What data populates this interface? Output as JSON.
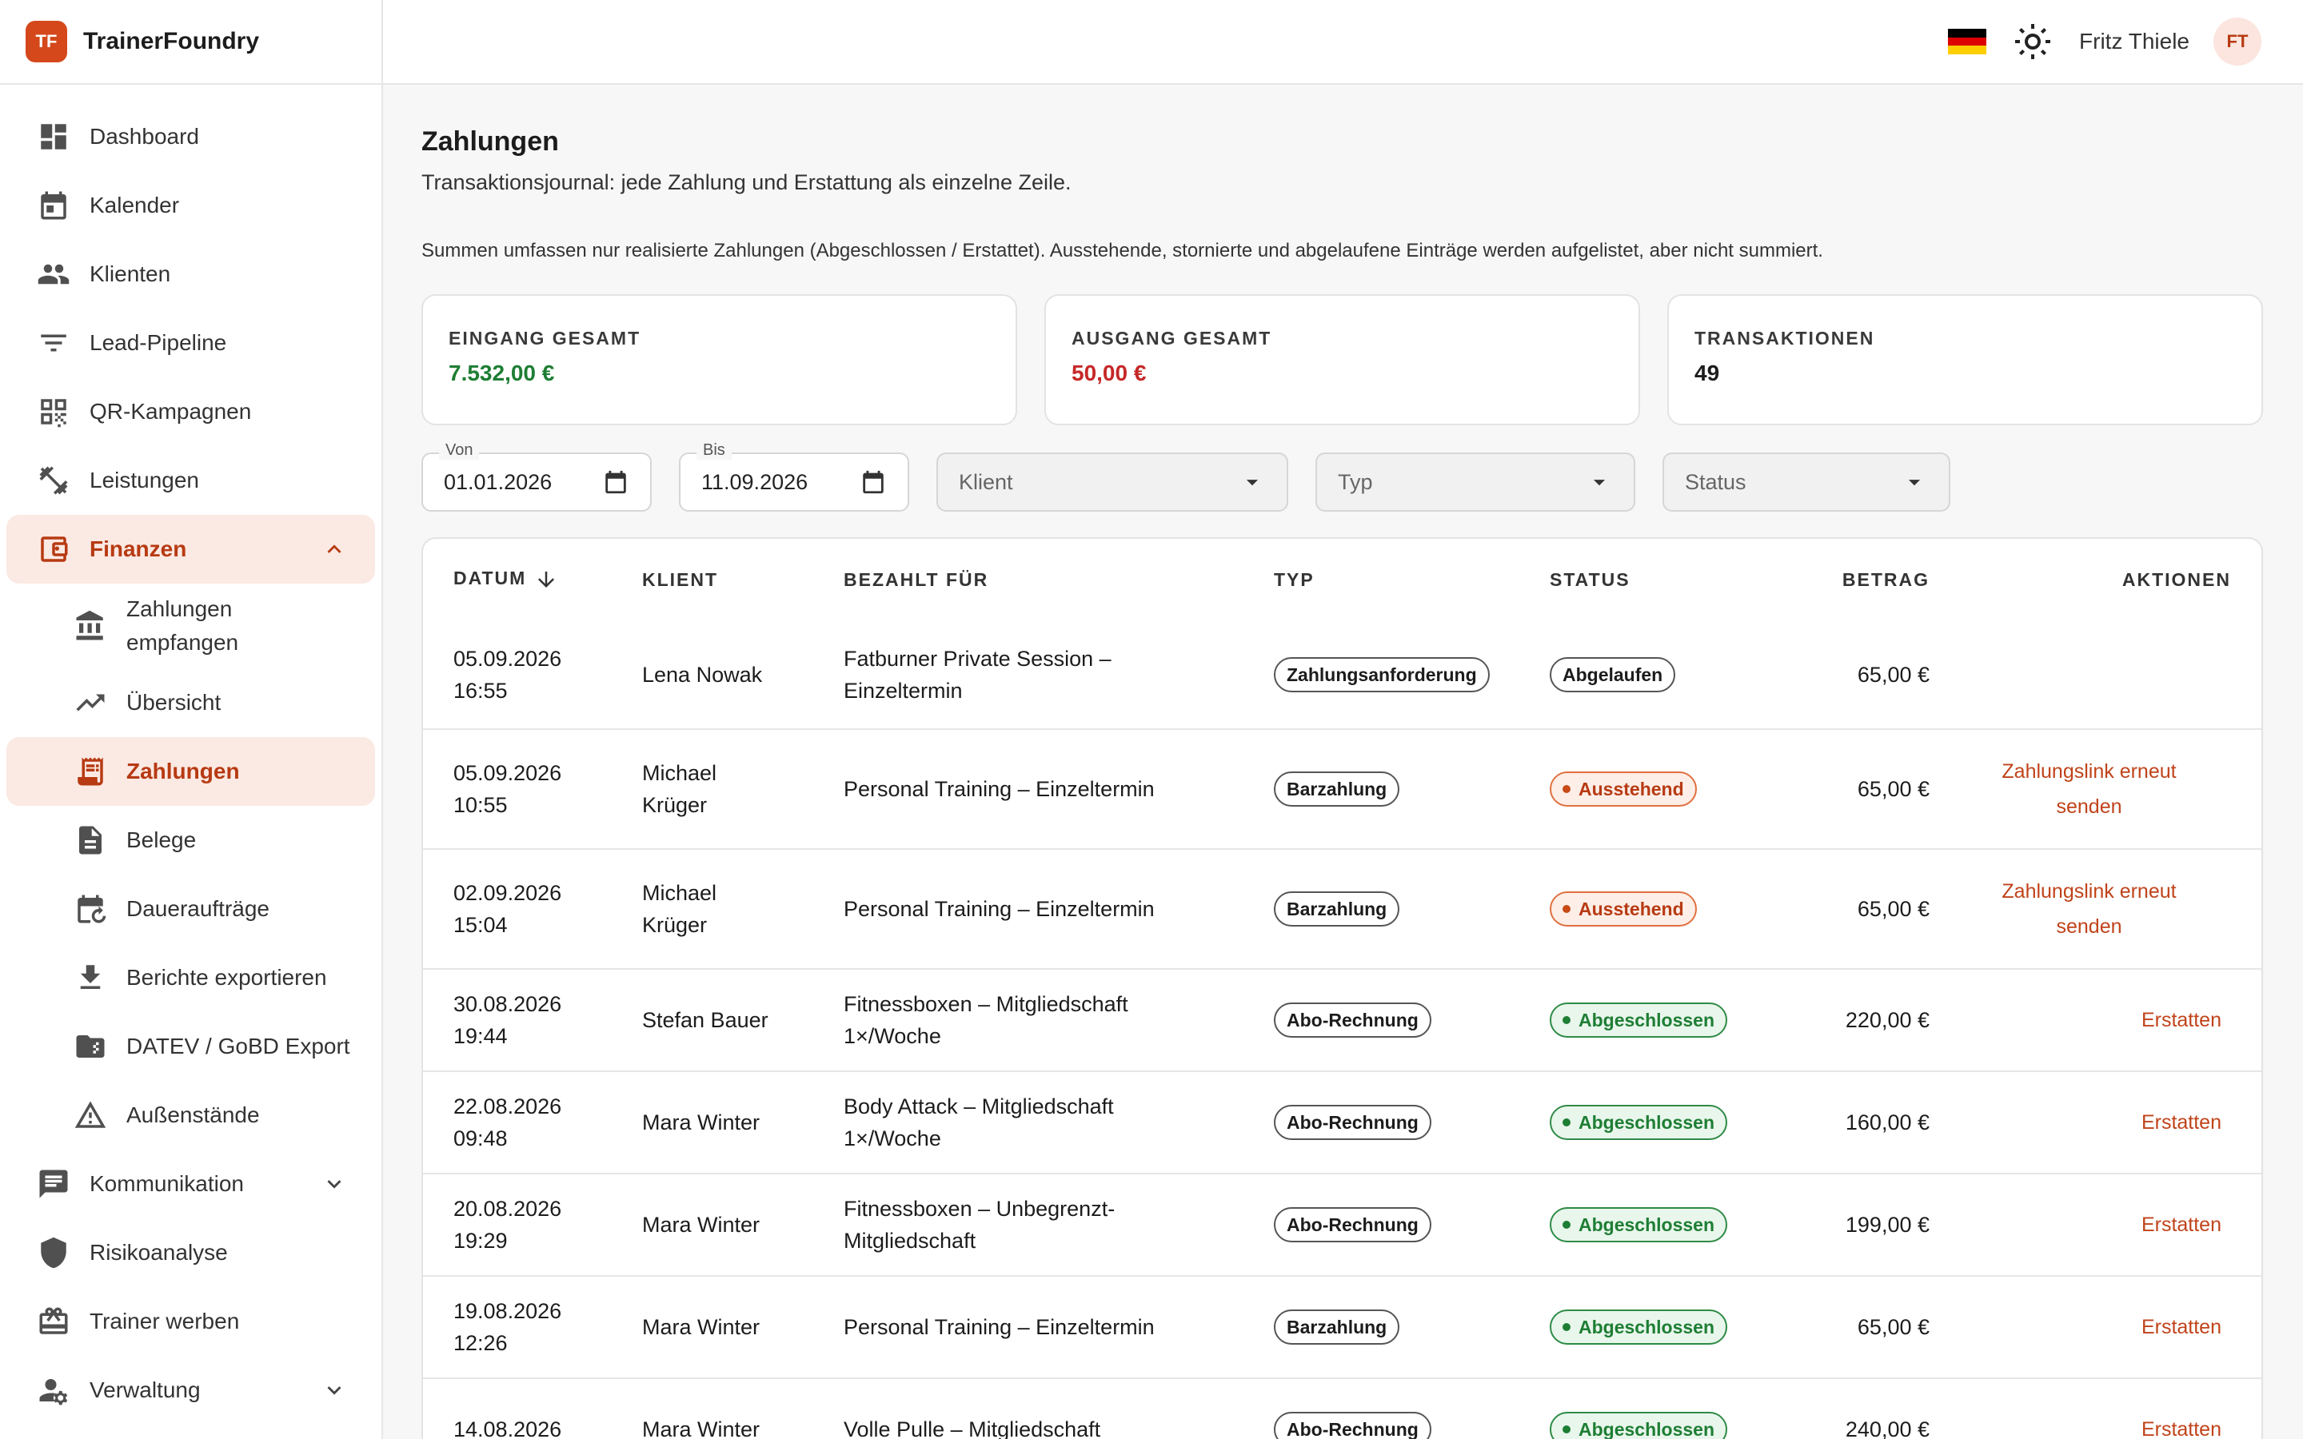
{
  "brand": {
    "logo": "TF",
    "name": "TrainerFoundry"
  },
  "sidebar": {
    "items": [
      {
        "label": "Dashboard",
        "icon": "dashboard-icon"
      },
      {
        "label": "Kalender",
        "icon": "calendar-icon"
      },
      {
        "label": "Klienten",
        "icon": "people-icon"
      },
      {
        "label": "Lead-Pipeline",
        "icon": "filter-icon"
      },
      {
        "label": "QR-Kampagnen",
        "icon": "qr-code-icon"
      },
      {
        "label": "Leistungen",
        "icon": "dumbbell-icon"
      },
      {
        "label": "Finanzen",
        "icon": "wallet-icon"
      },
      {
        "label": "Zahlungen empfangen",
        "icon": "bank-icon"
      },
      {
        "label": "Übersicht",
        "icon": "trending-up-icon"
      },
      {
        "label": "Zahlungen",
        "icon": "receipt-icon"
      },
      {
        "label": "Belege",
        "icon": "document-icon"
      },
      {
        "label": "Daueraufträge",
        "icon": "recurring-calendar-icon"
      },
      {
        "label": "Berichte exportieren",
        "icon": "download-icon"
      },
      {
        "label": "DATEV / GoBD Export",
        "icon": "folder-export-icon"
      },
      {
        "label": "Außenstände",
        "icon": "warning-icon"
      },
      {
        "label": "Kommunikation",
        "icon": "chat-icon"
      },
      {
        "label": "Risikoanalyse",
        "icon": "shield-icon"
      },
      {
        "label": "Trainer werben",
        "icon": "gift-icon"
      },
      {
        "label": "Verwaltung",
        "icon": "user-settings-icon"
      }
    ]
  },
  "topbar": {
    "user_name": "Fritz Thiele",
    "avatar": "FT",
    "language_flag": "de-flag-icon",
    "theme_icon": "sun-icon"
  },
  "page": {
    "title": "Zahlungen",
    "subtitle": "Transaktionsjournal: jede Zahlung und Erstattung als einzelne Zeile.",
    "note": "Summen umfassen nur realisierte Zahlungen (Abgeschlossen / Erstattet). Ausstehende, stornierte und abgelaufene Einträge werden aufgelistet, aber nicht summiert."
  },
  "summary": {
    "incoming": {
      "label": "EINGANG GESAMT",
      "value": "7.532,00 €",
      "color": "#1e7e34"
    },
    "outgoing": {
      "label": "AUSGANG GESAMT",
      "value": "50,00 €",
      "color": "#c62828"
    },
    "transactions": {
      "label": "TRANSAKTIONEN",
      "value": "49"
    }
  },
  "filters": {
    "from": {
      "label": "Von",
      "value": "01.01.2026"
    },
    "to": {
      "label": "Bis",
      "value": "11.09.2026"
    },
    "client": {
      "placeholder": "Klient"
    },
    "type": {
      "placeholder": "Typ"
    },
    "status": {
      "placeholder": "Status"
    }
  },
  "table": {
    "columns": {
      "date": "DATUM",
      "client": "KLIENT",
      "paid_for": "BEZAHLT FÜR",
      "type": "TYP",
      "status": "STATUS",
      "amount": "BETRAG",
      "actions": "AKTIONEN"
    },
    "rows": [
      {
        "date": "05.09.2026",
        "time": "16:55",
        "client_l1": "Lena Nowak",
        "client_l2": "",
        "paid_l1": "Fatburner Private Session –",
        "paid_l2": "Einzeltermin",
        "type": "Zahlungsanforderung",
        "status": "Abgelaufen",
        "amount": "65,00 €",
        "action_l1": "",
        "action_l2": ""
      },
      {
        "date": "05.09.2026",
        "time": "10:55",
        "client_l1": "Michael",
        "client_l2": "Krüger",
        "paid_l1": "Personal Training – Einzeltermin",
        "paid_l2": "",
        "type": "Barzahlung",
        "status": "Ausstehend",
        "amount": "65,00 €",
        "action_l1": "Zahlungslink erneut",
        "action_l2": "senden"
      },
      {
        "date": "02.09.2026",
        "time": "15:04",
        "client_l1": "Michael",
        "client_l2": "Krüger",
        "paid_l1": "Personal Training – Einzeltermin",
        "paid_l2": "",
        "type": "Barzahlung",
        "status": "Ausstehend",
        "amount": "65,00 €",
        "action_l1": "Zahlungslink erneut",
        "action_l2": "senden"
      },
      {
        "date": "30.08.2026",
        "time": "19:44",
        "client_l1": "Stefan Bauer",
        "client_l2": "",
        "paid_l1": "Fitnessboxen – Mitgliedschaft",
        "paid_l2": "1×/Woche",
        "type": "Abo-Rechnung",
        "status": "Abgeschlossen",
        "amount": "220,00 €",
        "action_l1": "Erstatten",
        "action_l2": ""
      },
      {
        "date": "22.08.2026",
        "time": "09:48",
        "client_l1": "Mara Winter",
        "client_l2": "",
        "paid_l1": "Body Attack – Mitgliedschaft",
        "paid_l2": "1×/Woche",
        "type": "Abo-Rechnung",
        "status": "Abgeschlossen",
        "amount": "160,00 €",
        "action_l1": "Erstatten",
        "action_l2": ""
      },
      {
        "date": "20.08.2026",
        "time": "19:29",
        "client_l1": "Mara Winter",
        "client_l2": "",
        "paid_l1": "Fitnessboxen – Unbegrenzt-",
        "paid_l2": "Mitgliedschaft",
        "type": "Abo-Rechnung",
        "status": "Abgeschlossen",
        "amount": "199,00 €",
        "action_l1": "Erstatten",
        "action_l2": ""
      },
      {
        "date": "19.08.2026",
        "time": "12:26",
        "client_l1": "Mara Winter",
        "client_l2": "",
        "paid_l1": "Personal Training – Einzeltermin",
        "paid_l2": "",
        "type": "Barzahlung",
        "status": "Abgeschlossen",
        "amount": "65,00 €",
        "action_l1": "Erstatten",
        "action_l2": ""
      },
      {
        "date": "14.08.2026",
        "time": "",
        "client_l1": "Mara Winter",
        "client_l2": "",
        "paid_l1": "Volle Pulle – Mitgliedschaft",
        "paid_l2": "",
        "type": "Abo-Rechnung",
        "status": "Abgeschlossen",
        "amount": "240,00 €",
        "action_l1": "Erstatten",
        "action_l2": ""
      }
    ]
  }
}
